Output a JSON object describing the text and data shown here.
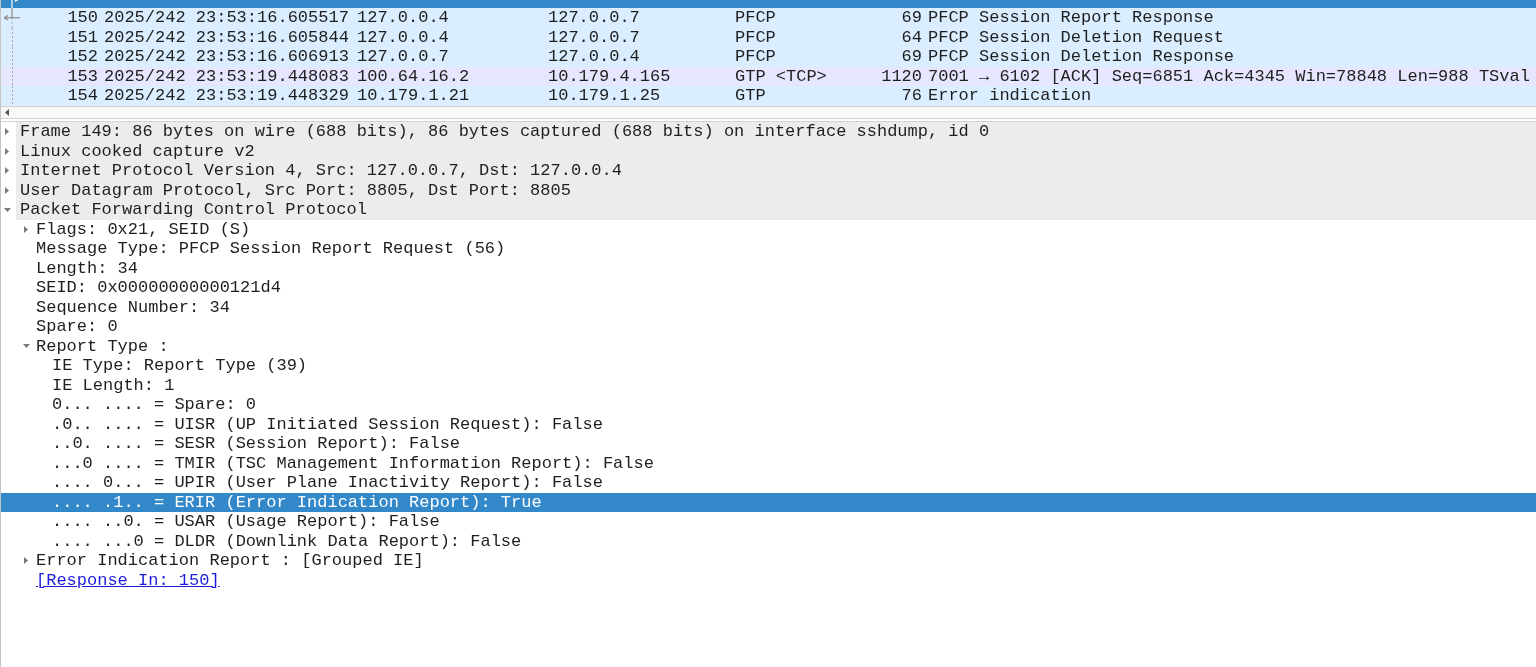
{
  "packets": [
    {
      "kind": "request",
      "selected": true
    },
    {
      "cells": [
        "150",
        "2025/242 23:53:16.605517",
        "127.0.0.4",
        "127.0.0.7",
        "PFCP",
        "69",
        "PFCP Session Report Response"
      ],
      "kind": "response",
      "selected": false,
      "color": "#daeeff"
    },
    {
      "cells": [
        "151",
        "2025/242 23:53:16.605844",
        "127.0.0.4",
        "127.0.0.7",
        "PFCP",
        "64",
        "PFCP Session Deletion Request"
      ],
      "kind": "other",
      "selected": false,
      "color": "#daeeff"
    },
    {
      "cells": [
        "152",
        "2025/242 23:53:16.606913",
        "127.0.0.7",
        "127.0.0.4",
        "PFCP",
        "69",
        "PFCP Session Deletion Response"
      ],
      "kind": "other",
      "selected": false,
      "color": "#daeeff"
    },
    {
      "cells": [
        "153",
        "2025/242 23:53:19.448083",
        "100.64.16.2",
        "10.179.4.165",
        "GTP <TCP>",
        "1120",
        "7001 → 6102 [ACK] Seq=6851 Ack=4345 Win=78848 Len=988 TSval"
      ],
      "kind": "other",
      "selected": false,
      "color": "#e7e6ff"
    },
    {
      "cells": [
        "154",
        "2025/242 23:53:19.448329",
        "10.179.1.21",
        "10.179.1.25",
        "GTP",
        "76",
        "Error indication"
      ],
      "kind": "other",
      "selected": false,
      "color": "#daeeff"
    }
  ],
  "details": [
    {
      "label": "Frame 149: 86 bytes on wire (688 bits), 86 bytes captured (688 bits) on interface sshdump, id 0",
      "kind": "field",
      "expanded": false,
      "selected": false
    },
    {
      "label": "Linux cooked capture v2",
      "kind": "field",
      "expanded": false,
      "selected": false
    },
    {
      "label": "Internet Protocol Version 4, Src: 127.0.0.7, Dst: 127.0.0.4",
      "kind": "field",
      "expanded": false,
      "selected": false
    },
    {
      "label": "User Datagram Protocol, Src Port: 8805, Dst Port: 8805",
      "kind": "field",
      "expanded": false,
      "selected": false
    },
    {
      "label": "Packet Forwarding Control Protocol",
      "kind": "field",
      "expanded": true,
      "selected": false,
      "children": [
        {
          "label": "Flags: 0x21, SEID (S)",
          "kind": "field",
          "expanded": false,
          "selected": false
        },
        {
          "label": "Message Type: PFCP Session Report Request (56)",
          "kind": "field",
          "selected": false
        },
        {
          "label": "Length: 34",
          "kind": "field",
          "selected": false
        },
        {
          "label": "SEID: 0x00000000000121d4",
          "kind": "field",
          "selected": false
        },
        {
          "label": "Sequence Number: 34",
          "kind": "field",
          "selected": false
        },
        {
          "label": "Spare: 0",
          "kind": "field",
          "selected": false
        },
        {
          "label": "Report Type :",
          "kind": "field",
          "expanded": true,
          "selected": false,
          "children": [
            {
              "label": "IE Type: Report Type (39)",
              "kind": "field",
              "selected": false
            },
            {
              "label": "IE Length: 1",
              "kind": "field",
              "selected": false
            },
            {
              "label": "0... .... = Spare: 0",
              "kind": "field",
              "selected": false
            },
            {
              "label": ".0.. .... = UISR (UP Initiated Session Request): False",
              "kind": "field",
              "selected": false
            },
            {
              "label": "..0. .... = SESR (Session Report): False",
              "kind": "field",
              "selected": false
            },
            {
              "label": "...0 .... = TMIR (TSC Management Information Report): False",
              "kind": "field",
              "selected": false
            },
            {
              "label": ".... 0... = UPIR (User Plane Inactivity Report): False",
              "kind": "field",
              "selected": false
            },
            {
              "label": ".... .1.. = ERIR (Error Indication Report): True",
              "kind": "field",
              "selected": true
            },
            {
              "label": ".... ..0. = USAR (Usage Report): False",
              "kind": "field",
              "selected": false
            },
            {
              "label": ".... ...0 = DLDR (Downlink Data Report): False",
              "kind": "field",
              "selected": false
            }
          ]
        },
        {
          "label": "Error Indication Report : [Grouped IE]",
          "kind": "field",
          "expanded": false,
          "selected": false
        },
        {
          "label": "[Response In: 150]",
          "kind": "link",
          "selected": false
        }
      ]
    }
  ]
}
